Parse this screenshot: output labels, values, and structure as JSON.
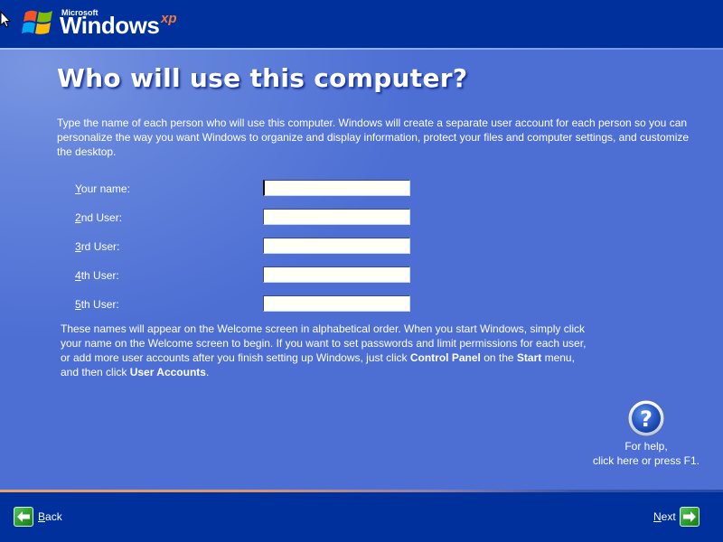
{
  "header": {
    "logo": {
      "brand_small": "Microsoft",
      "brand_main": "Windows",
      "brand_suffix": "xp",
      "flag_colors": [
        "#f35325",
        "#81bc06",
        "#05a6f0",
        "#ffba08"
      ]
    }
  },
  "page": {
    "title": "Who will use this computer?",
    "intro": "Type the name of each person who will use this computer. Windows will create a separate user account for each person so you can personalize the way you want Windows to organize and display information, protect your files and computer settings, and customize the desktop.",
    "fields": [
      {
        "label_access": "Y",
        "label_rest": "our name:",
        "value": "",
        "focused": true
      },
      {
        "label_access": "2",
        "label_rest": "nd User:",
        "value": ""
      },
      {
        "label_access": "3",
        "label_rest": "rd User:",
        "value": ""
      },
      {
        "label_access": "4",
        "label_rest": "th User:",
        "value": ""
      },
      {
        "label_access": "5",
        "label_rest": "th User:",
        "value": ""
      }
    ],
    "outro": {
      "part1": "These names will appear on the Welcome screen in alphabetical order. When you start Windows, simply click your name on the Welcome screen to begin. If you want to set passwords and limit permissions for each user, or add more user accounts after you finish setting up Windows, just click ",
      "bold1": "Control Panel",
      "part2": " on the ",
      "bold2": "Start",
      "part3": " menu, and then click ",
      "bold3": "User Accounts",
      "part4": "."
    }
  },
  "help": {
    "icon": "help-question-icon",
    "line1": "For help,",
    "line2": "click here or press F1."
  },
  "footer": {
    "back": {
      "access": "B",
      "rest": "ack",
      "icon": "arrow-left-icon"
    },
    "next": {
      "access": "N",
      "rest": "ext",
      "icon": "arrow-right-icon"
    }
  },
  "colors": {
    "header_bg": "#00309c",
    "body_bg": "#4d6fd4",
    "accent_orange": "#f47a3c",
    "button_green": "#2f9f2f"
  }
}
